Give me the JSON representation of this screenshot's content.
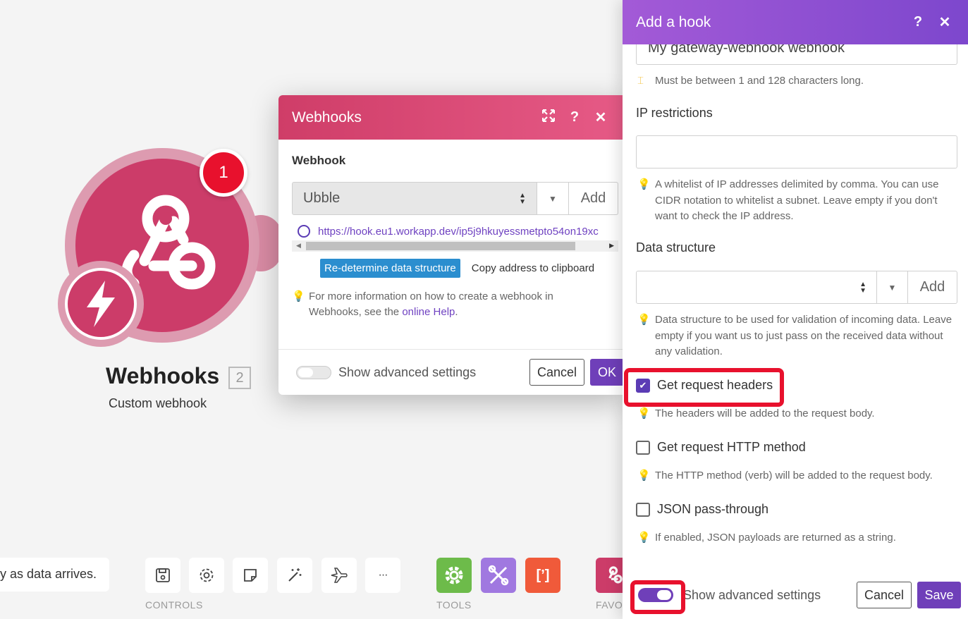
{
  "module": {
    "title": "Webhooks",
    "count": "2",
    "subtitle": "Custom webhook",
    "badge": "1",
    "color": "#cc3c69"
  },
  "toolbar": {
    "hint": "y as data arrives.",
    "controls_label": "CONTROLS",
    "tools_label": "TOOLS",
    "favorites_label": "FAVO",
    "controls": [
      "save-icon",
      "gear-icon",
      "note-icon",
      "magic-wand-icon",
      "airplane-icon",
      "more-icon"
    ],
    "more_glyph": "···",
    "tools": [
      {
        "name": "gear-tool-icon",
        "color": "#6dbb4a"
      },
      {
        "name": "tools-icon",
        "color": "#a078e0"
      },
      {
        "name": "json-icon",
        "color": "#f05a3a",
        "glyph": "[’]"
      }
    ]
  },
  "webhooks_dialog": {
    "title": "Webhooks",
    "field_label": "Webhook",
    "selected": "Ubble",
    "add_label": "Add",
    "url": "https://hook.eu1.workapp.dev/ip5j9hkuyessmetpto54on19xc",
    "redetermine_label": "Re-determine data structure",
    "copy_label": "Copy address to clipboard",
    "info_prefix": "For more information on how to create a webhook in Webhooks, see the",
    "info_link": "online Help",
    "info_suffix": ".",
    "advanced_label": "Show advanced settings",
    "cancel_label": "Cancel",
    "ok_label": "OK",
    "header_color": "#cf3d68"
  },
  "hook_panel": {
    "title": "Add a hook",
    "name_value": "My gateway-webhook webhook",
    "name_help": "Must be between 1 and 128 characters long.",
    "ip_label": "IP restrictions",
    "ip_value": "",
    "ip_help": "A whitelist of IP addresses delimited by comma. You can use CIDR notation to whitelist a subnet. Leave empty if you don't want to check the IP address.",
    "ds_label": "Data structure",
    "ds_add_label": "Add",
    "ds_help": "Data structure to be used for validation of incoming data. Leave empty if you want us to just pass on the received data without any validation.",
    "options": [
      {
        "label": "Get request headers",
        "checked": true,
        "help": "The headers will be added to the request body."
      },
      {
        "label": "Get request HTTP method",
        "checked": false,
        "help": "The HTTP method (verb) will be added to the request body."
      },
      {
        "label": "JSON pass-through",
        "checked": false,
        "help": "If enabled, JSON payloads are returned as a string."
      }
    ],
    "advanced_label": "Show advanced settings",
    "advanced_on": true,
    "cancel_label": "Cancel",
    "save_label": "Save",
    "header_color": "#8b4fd1",
    "highlight_color": "#e8112d"
  }
}
